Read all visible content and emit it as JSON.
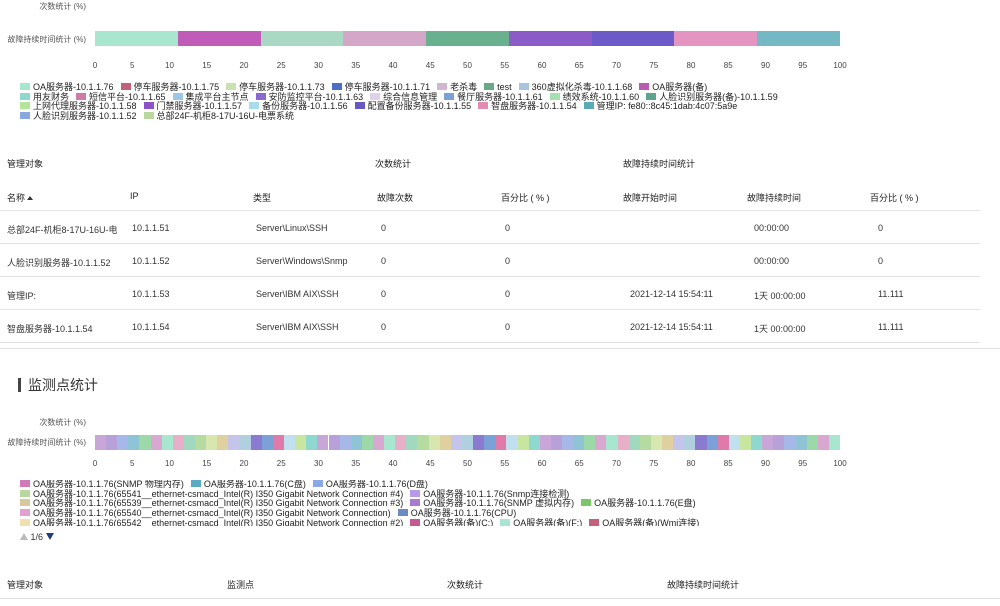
{
  "chart1": {
    "row1_label": "次数统计 (%)",
    "row2_label": "故障持续时间统计 (%)",
    "ticks": [
      "0",
      "5",
      "10",
      "15",
      "20",
      "25",
      "30",
      "35",
      "40",
      "45",
      "50",
      "55",
      "60",
      "65",
      "70",
      "75",
      "80",
      "85",
      "90",
      "95",
      "100"
    ]
  },
  "chart_data": [
    {
      "type": "bar",
      "orientation": "horizontal-stacked",
      "categories": [
        "次数统计 (%)",
        "故障持续时间统计 (%)"
      ],
      "xlim": [
        0,
        100
      ],
      "series": [
        {
          "name": "OA服务器-10.1.1.76",
          "color": "#a8e6cf",
          "values": [
            0,
            11.111
          ]
        },
        {
          "name": "停车服务器-10.1.1.75",
          "color": "#c05bb8",
          "values": [
            0,
            11.111
          ]
        },
        {
          "name": "停车服务器-10.1.1.73",
          "color": "#a9d8c5",
          "values": [
            0,
            11.111
          ]
        },
        {
          "name": "停车服务器-10.1.1.71",
          "color": "#d4a6c8",
          "values": [
            0,
            11.111
          ]
        },
        {
          "name": "老杀毒",
          "color": "#69b08f",
          "values": [
            0,
            11.111
          ]
        },
        {
          "name": "test",
          "color": "#8b5cc7",
          "values": [
            0,
            11.111
          ]
        },
        {
          "name": "360虚拟化杀毒-10.1.1.68",
          "color": "#6b5ac8",
          "values": [
            0,
            11.111
          ]
        },
        {
          "name": "OA服务器(备)",
          "color": "#e494c0",
          "values": [
            0,
            11.111
          ]
        },
        {
          "name": "用友财务",
          "color": "#74b8c4",
          "values": [
            0,
            11.111
          ]
        }
      ]
    },
    {
      "type": "bar",
      "orientation": "horizontal-stacked",
      "categories": [
        "次数统计 (%)",
        "故障持续时间统计 (%)"
      ],
      "xlim": [
        0,
        100
      ],
      "note_segments": 67
    }
  ],
  "legend1": [
    [
      {
        "label": "OA服务器-10.1.1.76",
        "color": "#a8e6cf"
      },
      {
        "label": "停车服务器-10.1.1.75",
        "color": "#c4617a"
      },
      {
        "label": "停车服务器-10.1.1.73",
        "color": "#c6e3b0"
      },
      {
        "label": "停车服务器-10.1.1.71",
        "color": "#4a6fc4"
      },
      {
        "label": "老杀毒",
        "color": "#d1b6cf"
      },
      {
        "label": "test",
        "color": "#6aa88a"
      },
      {
        "label": "360虚拟化杀毒-10.1.1.68",
        "color": "#a8c4e0"
      },
      {
        "label": "OA服务器(备)",
        "color": "#b95bb0"
      }
    ],
    [
      {
        "label": "用友财务",
        "color": "#8ed8d0"
      },
      {
        "label": "短信平台-10.1.1.65",
        "color": "#d07aa8"
      },
      {
        "label": "集成平台主节点",
        "color": "#9cc7e6"
      },
      {
        "label": "安防监控平台-10.1.1.63",
        "color": "#8a6ad0"
      },
      {
        "label": "综合信息管理",
        "color": "#e0d0ec"
      },
      {
        "label": "餐厅服务器-10.1.1.61",
        "color": "#7ca0d8"
      },
      {
        "label": "绩效系统-10.1.1.60",
        "color": "#a6e0b0"
      },
      {
        "label": "人脸识别服务器(备)-10.1.1.59",
        "color": "#5aa58c"
      }
    ],
    [
      {
        "label": "上网代理服务器-10.1.1.58",
        "color": "#b3e59a"
      },
      {
        "label": "门禁服务器-10.1.1.57",
        "color": "#8e52c8"
      },
      {
        "label": "备份服务器-10.1.1.56",
        "color": "#a8dcea"
      },
      {
        "label": "配置备份服务器-10.1.1.55",
        "color": "#6a58c0"
      },
      {
        "label": "智盘服务器-10.1.1.54",
        "color": "#e08ab4"
      },
      {
        "label": "管理IP: fe80::8c45:1dab:4c07:5a9e",
        "color": "#5aaab8"
      }
    ],
    [
      {
        "label": "人脸识别服务器-10.1.1.52",
        "color": "#8aa8e0"
      },
      {
        "label": "总部24F-机柜8-17U-16U-电票系统",
        "color": "#b8d8a0"
      }
    ]
  ],
  "table1": {
    "group_headers": {
      "object": "管理对象",
      "count": "次数统计",
      "duration": "故障持续时间统计"
    },
    "columns": [
      "名称",
      "IP",
      "类型",
      "故障次数",
      "百分比 ( % )",
      "故障开始时间",
      "故障持续时间",
      "百分比 ( % )"
    ],
    "rows": [
      [
        "总部24F-机柜8-17U-16U-电",
        "10.1.1.51",
        "Server\\Linux\\SSH",
        "0",
        "0",
        "",
        "00:00:00",
        "0"
      ],
      [
        "人脸识别服务器-10.1.1.52",
        "10.1.1.52",
        "Server\\Windows\\Snmp",
        "0",
        "0",
        "",
        "00:00:00",
        "0"
      ],
      [
        "管理IP:",
        "10.1.1.53",
        "Server\\IBM AIX\\SSH",
        "0",
        "0",
        "2021-12-14 15:54:11",
        "1天 00:00:00",
        "11.111"
      ],
      [
        "智盘服务器-10.1.1.54",
        "10.1.1.54",
        "Server\\IBM AIX\\SSH",
        "0",
        "0",
        "2021-12-14 15:54:11",
        "1天 00:00:00",
        "11.111"
      ]
    ]
  },
  "section2": {
    "title": "监测点统计"
  },
  "chart2": {
    "row1_label": "次数统计 (%)",
    "row2_label": "故障持续时间统计 (%)",
    "ticks": [
      "0",
      "5",
      "10",
      "15",
      "20",
      "25",
      "30",
      "35",
      "40",
      "45",
      "50",
      "55",
      "60",
      "65",
      "70",
      "75",
      "80",
      "85",
      "90",
      "95",
      "100"
    ],
    "palette": [
      "#c9a6d8",
      "#8ec4d6",
      "#a8e6cf",
      "#b5dba0",
      "#c5c5ec",
      "#7ca0d8",
      "#c8e6a0",
      "#b8a0d8",
      "#9cd8a8",
      "#e8b0c8",
      "#d8e6b0",
      "#b0d0e0",
      "#e07aa8",
      "#8ed8d0",
      "#a6b8e8",
      "#d8a8d0",
      "#a0d8c0",
      "#e0d0a0",
      "#8a7ad0",
      "#c0e0f0"
    ]
  },
  "legend2": [
    [
      {
        "label": "OA服务器-10.1.1.76(SNMP 物理内存)",
        "color": "#d07ab8"
      },
      {
        "label": "OA服务器-10.1.1.76(C盘)",
        "color": "#5aaac4"
      },
      {
        "label": "OA服务器-10.1.1.76(D盘)",
        "color": "#8aa8e8"
      }
    ],
    [
      {
        "label": "OA服务器-10.1.1.76(65541__ethernet-csmacd_Intel(R) I350 Gigabit Network Connection #4)",
        "color": "#b8d8a0"
      },
      {
        "label": "OA服务器-10.1.1.76(Snmp连接检测)",
        "color": "#b89ae8"
      }
    ],
    [
      {
        "label": "OA服务器-10.1.1.76(65539__ethernet-csmacd_Intel(R) I350 Gigabit Network Connection #3)",
        "color": "#d8c8a0"
      },
      {
        "label": "OA服务器-10.1.1.76(SNMP 虚拟内存)",
        "color": "#a87ad0"
      },
      {
        "label": "OA服务器-10.1.1.76(E盘)",
        "color": "#7ac86a"
      }
    ],
    [
      {
        "label": "OA服务器-10.1.1.76(65540__ethernet-csmacd_Intel(R) I350 Gigabit Network Connection)",
        "color": "#e0a0d0"
      },
      {
        "label": "OA服务器-10.1.1.76(CPU)",
        "color": "#6a8ac4"
      }
    ],
    [
      {
        "label": "OA服务器-10.1.1.76(65542__ethernet-csmacd_Intel(R) I350 Gigabit Network Connection #2)",
        "color": "#f0e0b0"
      },
      {
        "label": "OA服务器(备)(C:)",
        "color": "#c45a90"
      },
      {
        "label": "OA服务器(备)(F:)",
        "color": "#a8e6cf"
      },
      {
        "label": "OA服务器(备)(Wmi连接)",
        "color": "#c4607a"
      }
    ]
  ],
  "pager": {
    "text": "1/6"
  },
  "table2": {
    "group_headers": {
      "object": "管理对象",
      "point": "监测点",
      "count": "次数统计",
      "duration": "故障持续时间统计"
    }
  }
}
